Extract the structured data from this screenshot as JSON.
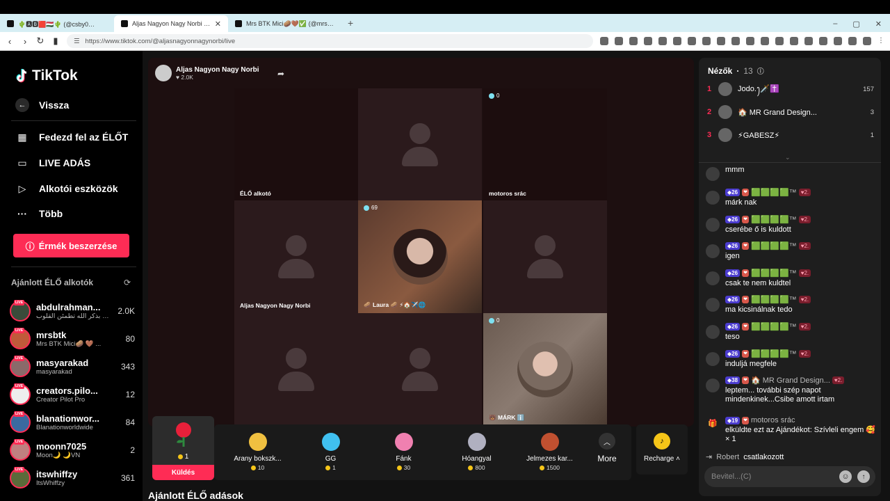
{
  "browser": {
    "tabs": [
      {
        "title": "🌵🅰🅱🟥🇭🇺🌵 (@csby0…"
      },
      {
        "title": "Aljas Nagyon Nagy Norbi (@…"
      },
      {
        "title": "Mrs BTK Mici🥔🤎✅ (@mrsbtk) l…"
      }
    ],
    "url": "https://www.tiktok.com/@aljasnagyonnagynorbi/live"
  },
  "sidebar": {
    "logo": "TikTok",
    "back": "Vissza",
    "nav": [
      "Fedezd fel az ÉLŐT",
      "LIVE ADÁS",
      "Alkotói eszközök",
      "Több"
    ],
    "coins_button": "Érmék beszerzése",
    "recommended_title": "Ajánlott ÉLŐ alkotók",
    "creators": [
      {
        "name": "abdulrahman...",
        "sub": "الا بذكر الله تطمئن القلوب ...",
        "count": "2.0K",
        "color": "#3a4b3a"
      },
      {
        "name": "mrsbtk",
        "sub": "Mrs BTK Mici🥔 🤎 ...",
        "count": "80",
        "color": "#c05a3a"
      },
      {
        "name": "masyarakad",
        "sub": "masyarakad",
        "count": "343",
        "color": "#8a6a6a"
      },
      {
        "name": "creators.pilo...",
        "sub": "Creator Pilot Pro",
        "count": "12",
        "color": "#eeeeee"
      },
      {
        "name": "blanationwor...",
        "sub": "Blanationworldwide",
        "count": "84",
        "color": "#3a6aa0"
      },
      {
        "name": "moonn7025",
        "sub": "Moon🌙 🌙VN",
        "count": "2",
        "color": "#c08080"
      },
      {
        "name": "itswhiffzy",
        "sub": "ItsWhiffzy",
        "count": "361",
        "color": "#5a6a3a"
      }
    ]
  },
  "stream": {
    "host_name": "Aljas Nagyon Nagy Norbi",
    "host_likes": "2.0K",
    "cells": [
      {
        "label": "ÉLŐ alkotó",
        "badge": "",
        "type": "empty"
      },
      {
        "label": "",
        "badge": "",
        "type": "person"
      },
      {
        "label": "motoros srác",
        "badge": "0",
        "type": "empty"
      },
      {
        "label": "Aljas Nagyon Nagy Norbi",
        "badge": "",
        "type": "person"
      },
      {
        "label": "🥔 Laura 🥔 ⚡🏠✈️🌐",
        "badge": "69",
        "type": "face1"
      },
      {
        "label": "",
        "badge": "",
        "type": "person"
      },
      {
        "label": "",
        "badge": "",
        "type": "person"
      },
      {
        "label": "",
        "badge": "",
        "type": "person"
      },
      {
        "label": "🐻 MÁRK ℹ️",
        "badge": "0",
        "type": "face2"
      }
    ]
  },
  "gifts": {
    "selected_count": "1",
    "send_label": "Küldés",
    "items": [
      {
        "name": "Arany bokszk...",
        "price": "10",
        "color": "#f0c040"
      },
      {
        "name": "GG",
        "price": "1",
        "color": "#40c0f0"
      },
      {
        "name": "Fánk",
        "price": "30",
        "color": "#f080b0"
      },
      {
        "name": "Hóangyal",
        "price": "800",
        "color": "#b0b0c0"
      },
      {
        "name": "Jelmezes kar...",
        "price": "1500",
        "color": "#c05030"
      }
    ],
    "more": "More",
    "recharge": "Recharge"
  },
  "bottom_title": "Ajánlott ÉLŐ adások",
  "chat": {
    "viewers_label": "Nézők",
    "viewers_count": "13",
    "viewers": [
      {
        "rank": "1",
        "name": "Jodo.ꫂ🗡️✝️",
        "score": "157"
      },
      {
        "rank": "2",
        "name": "🏠 MR Grand Design...",
        "score": "3"
      },
      {
        "rank": "3",
        "name": "⚡GABESZ⚡",
        "score": "1"
      }
    ],
    "messages": [
      {
        "level": "",
        "user": "",
        "fan": "",
        "text": "mmm"
      },
      {
        "level": "26",
        "user": "🟩🟩🟩🟩™",
        "fan": "2.",
        "text": "márk nak"
      },
      {
        "level": "26",
        "user": "🟩🟩🟩🟩™",
        "fan": "2.",
        "text": "cserébe ő is kuldott"
      },
      {
        "level": "26",
        "user": "🟩🟩🟩🟩™",
        "fan": "2.",
        "text": "igen"
      },
      {
        "level": "26",
        "user": "🟩🟩🟩🟩™",
        "fan": "2.",
        "text": "csak te nem kuldtel"
      },
      {
        "level": "26",
        "user": "🟩🟩🟩🟩™",
        "fan": "2.",
        "text": "ma kicsinálnak tedo"
      },
      {
        "level": "26",
        "user": "🟩🟩🟩🟩™",
        "fan": "2.",
        "text": "teso"
      },
      {
        "level": "26",
        "user": "🟩🟩🟩🟩™",
        "fan": "2.",
        "text": "induljá megfele"
      },
      {
        "level": "38",
        "user": "🏠 MR Grand Design...",
        "fan": "2.",
        "text": "leptem... további szép napot mindenkinek...Csibe amott irtam"
      },
      {
        "level": "19",
        "user": "motoros srác",
        "fan": "",
        "text": "elküldte ezt az Ajándékot: Szívleli engem 🥰 × 1"
      }
    ],
    "joined_user": "Robert",
    "joined_text": "csatlakozott",
    "input_placeholder": "Bevitel...(C)"
  }
}
